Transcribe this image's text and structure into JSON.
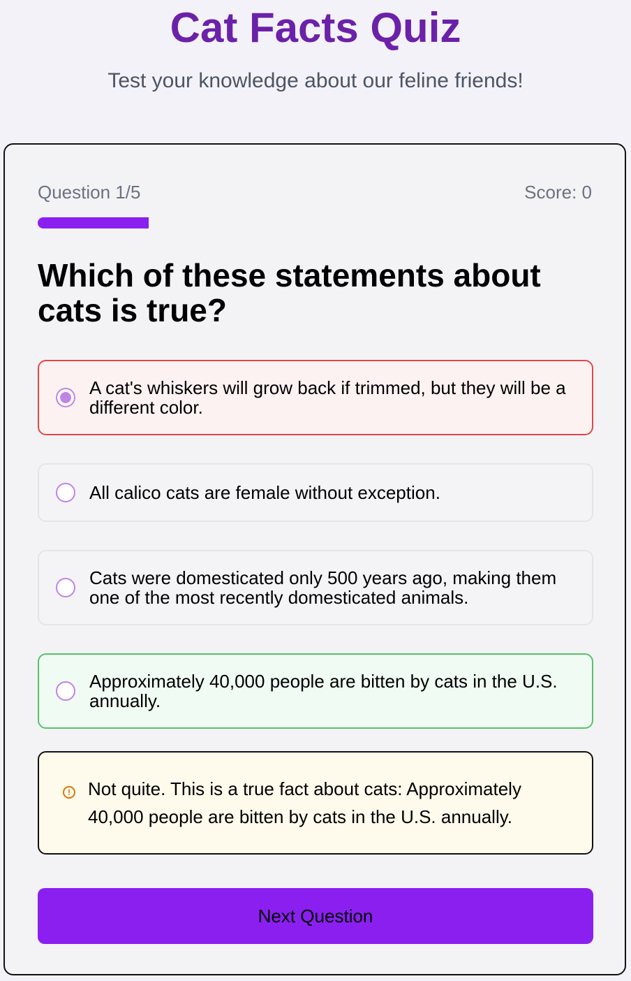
{
  "header": {
    "title": "Cat Facts Quiz",
    "subtitle": "Test your knowledge about our feline friends!"
  },
  "quiz": {
    "progress_label": "Question 1/5",
    "score_label": "Score: 0",
    "progress_fraction": 0.2,
    "question": "Which of these statements about cats is true?",
    "options": [
      {
        "label": "A cat's whiskers will grow back if trimmed, but they will be a different color.",
        "state": "selected-incorrect",
        "checked": true
      },
      {
        "label": "All calico cats are female without exception.",
        "state": "neutral",
        "checked": false
      },
      {
        "label": "Cats were domesticated only 500 years ago, making them one of the most recently domesticated animals.",
        "state": "neutral",
        "checked": false
      },
      {
        "label": "Approximately 40,000 people are bitten by cats in the U.S. annually.",
        "state": "correct",
        "checked": false
      }
    ],
    "feedback": {
      "icon": "warning-circle-icon",
      "text": "Not quite. This is a true fact about cats: Approximately 40,000 people are bitten by cats in the U.S. annually."
    },
    "next_button_label": "Next Question"
  },
  "colors": {
    "accent": "#8b1ff0",
    "title": "#6b21a8",
    "incorrect_border": "#e04747",
    "correct_border": "#55c26a",
    "feedback_background": "#fefaec"
  }
}
